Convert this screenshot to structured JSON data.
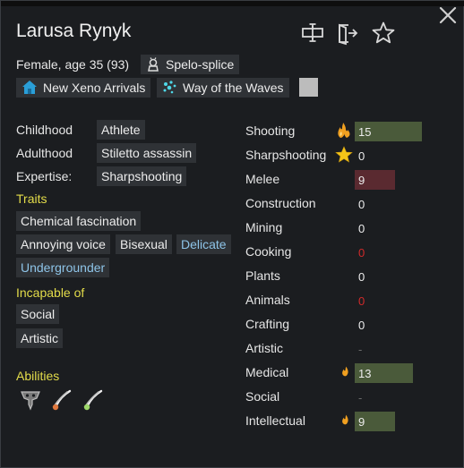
{
  "pawn": {
    "name": "Larusa Rynyk",
    "summary": "Female, age 35 (93)",
    "xenotype": "Spelo-splice",
    "faction": "New Xeno Arrivals",
    "ideoligion": "Way of the Waves"
  },
  "backstory": {
    "childhood_label": "Childhood",
    "childhood": "Athlete",
    "adulthood_label": "Adulthood",
    "adulthood": "Stiletto assassin",
    "expertise_label": "Expertise:",
    "expertise": "Sharpshooting"
  },
  "traits": {
    "heading": "Traits",
    "items": [
      "Chemical fascination",
      "Annoying voice",
      "Bisexual",
      "Delicate",
      "Undergrounder"
    ]
  },
  "incapable": {
    "heading": "Incapable of",
    "items": [
      "Social",
      "Artistic"
    ]
  },
  "abilities": {
    "heading": "Abilities",
    "icons": [
      "mask-ability-icon",
      "claw-red-ability-icon",
      "claw-green-ability-icon"
    ]
  },
  "skills": [
    {
      "name": "Shooting",
      "level": "15",
      "passion": "major",
      "fill": 0.75,
      "bar_color": "#4a5a3a"
    },
    {
      "name": "Sharpshooting",
      "level": "0",
      "passion": "star",
      "fill": 0,
      "bar_color": ""
    },
    {
      "name": "Melee",
      "level": "9",
      "passion": "none",
      "fill": 0.45,
      "bar_color": "#5a2a30"
    },
    {
      "name": "Construction",
      "level": "0",
      "passion": "none",
      "fill": 0,
      "bar_color": ""
    },
    {
      "name": "Mining",
      "level": "0",
      "passion": "none",
      "fill": 0,
      "bar_color": ""
    },
    {
      "name": "Cooking",
      "level": "0",
      "passion": "none",
      "fill": 0,
      "bar_color": "",
      "red": true
    },
    {
      "name": "Plants",
      "level": "0",
      "passion": "none",
      "fill": 0,
      "bar_color": ""
    },
    {
      "name": "Animals",
      "level": "0",
      "passion": "none",
      "fill": 0,
      "bar_color": "",
      "red": true
    },
    {
      "name": "Crafting",
      "level": "0",
      "passion": "none",
      "fill": 0,
      "bar_color": ""
    },
    {
      "name": "Artistic",
      "level": "-",
      "passion": "none",
      "fill": 0,
      "bar_color": "",
      "disabled": true
    },
    {
      "name": "Medical",
      "level": "13",
      "passion": "minor",
      "fill": 0.65,
      "bar_color": "#4a5a3a"
    },
    {
      "name": "Social",
      "level": "-",
      "passion": "none",
      "fill": 0,
      "bar_color": "",
      "disabled": true
    },
    {
      "name": "Intellectual",
      "level": "9",
      "passion": "minor",
      "fill": 0.45,
      "bar_color": "#4a5a3a"
    }
  ],
  "colors": {
    "accent_yellow": "#e3dc4a",
    "trait_blue": "#8ec4e8",
    "skill_bar": "#4a5a3a",
    "skill_bar_bad": "#5a2a30",
    "unwilling_red": "#d02a2a"
  },
  "icons": {
    "close": "close-icon",
    "rename": "rename-icon",
    "banish": "banish-icon",
    "favorite": "star-icon",
    "xenotype": "xenotype-icon",
    "faction": "house-icon",
    "ideoligion": "ideo-splash-icon"
  }
}
